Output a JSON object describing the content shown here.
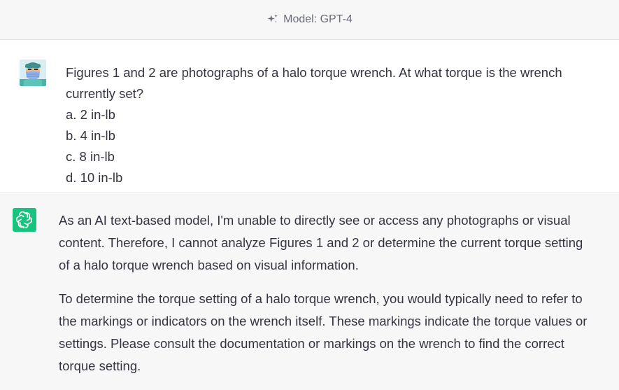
{
  "header": {
    "model_label": "Model: GPT-4",
    "icon": "sparkle-icon"
  },
  "user_message": {
    "avatar": "user-avatar",
    "question": "Figures 1 and 2 are photographs of a halo torque wrench. At what torque is the wrench currently set?",
    "options": [
      "a. 2 in-lb",
      "b. 4 in-lb",
      "c. 8 in-lb",
      "d. 10 in-lb"
    ]
  },
  "assistant_message": {
    "avatar": "openai-logo-icon",
    "paragraph1_lines": [
      "As an AI text-based model, I'm unable to directly see or access any photographs or visual",
      "content. Therefore, I cannot analyze Figures 1 and 2 or determine the current torque setting",
      "of a halo torque wrench based on visual information."
    ],
    "paragraph2_lines": [
      "To determine the torque setting of a halo torque wrench, you would typically need to refer to",
      "the markings or indicators on the wrench itself. These markings indicate the torque values or",
      "settings. Please consult the documentation or markings on the wrench to find the correct",
      "torque setting."
    ]
  },
  "colors": {
    "accent": "#19c37d",
    "text": "#343541",
    "muted": "#6b6c7b",
    "assistant_bg": "#f7f7f8"
  }
}
